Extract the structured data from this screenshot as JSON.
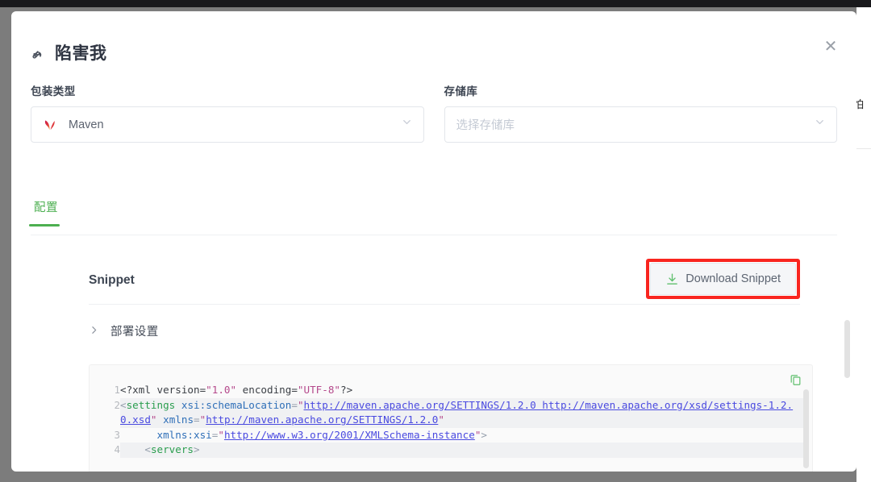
{
  "modal": {
    "title": "陷害我",
    "title_icon": "wrench-icon",
    "close_icon": "close-icon"
  },
  "form": {
    "package_type": {
      "label": "包装类型",
      "value": "Maven",
      "icon": "maven-icon",
      "chevron": "chevron-down-icon"
    },
    "repository": {
      "label": "存储库",
      "value": "",
      "placeholder": "选择存储库",
      "chevron": "chevron-down-icon"
    }
  },
  "tabs": [
    {
      "label": "配置",
      "active": true
    }
  ],
  "snippet": {
    "title": "Snippet",
    "download_label": "Download Snippet",
    "download_icon": "download-icon",
    "highlight_color": "#f9251f",
    "accent_color": "#4caf50",
    "copy_icon": "copy-icon"
  },
  "collapsible": {
    "label": "部署设置",
    "arrow_icon": "chevron-right-icon",
    "expanded": false
  },
  "code": {
    "lines": [
      {
        "number": "1",
        "text": "<?xml version=\"1.0\" encoding=\"UTF-8\"?>"
      },
      {
        "number": "2",
        "text": "<settings xsi:schemaLocation=\"http://maven.apache.org/SETTINGS/1.2.0 http://maven.apache.org/xsd/settings-1.2.0.xsd\" xmlns=\"http://maven.apache.org/SETTINGS/1.2.0\""
      },
      {
        "number": "3",
        "text": "      xmlns:xsi=\"http://www.w3.org/2001/XMLSchema-instance\">"
      },
      {
        "number": "4",
        "text": "    <servers>"
      }
    ]
  },
  "background": {
    "sliver_text": "怕"
  }
}
